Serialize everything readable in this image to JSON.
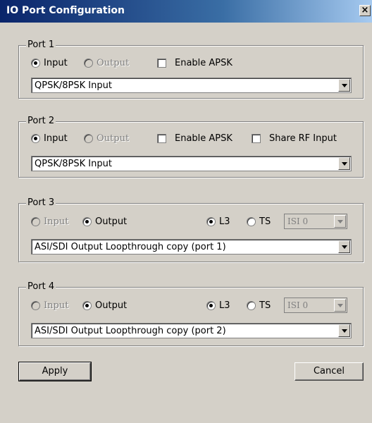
{
  "window": {
    "title": "IO Port Configuration",
    "close_label": "×"
  },
  "ports": [
    {
      "label": "Port 1",
      "input_label": "Input",
      "input_checked": true,
      "output_label": "Output",
      "apsk_label": "Enable APSK",
      "select_value": "QPSK/8PSK Input"
    },
    {
      "label": "Port 2",
      "input_label": "Input",
      "input_checked": true,
      "output_label": "Output",
      "apsk_label": "Enable APSK",
      "share_rf_label": "Share RF Input",
      "select_value": "QPSK/8PSK Input"
    },
    {
      "label": "Port 3",
      "input_label": "Input",
      "output_label": "Output",
      "output_checked": true,
      "l3_label": "L3",
      "l3_checked": true,
      "ts_label": "TS",
      "isi_value": "ISI 0",
      "select_value": "ASI/SDI Output Loopthrough copy (port 1)"
    },
    {
      "label": "Port 4",
      "input_label": "Input",
      "output_label": "Output",
      "output_checked": true,
      "l3_label": "L3",
      "l3_checked": true,
      "ts_label": "TS",
      "isi_value": "ISI 0",
      "select_value": "ASI/SDI Output Loopthrough copy (port 2)"
    }
  ],
  "buttons": {
    "apply": "Apply",
    "cancel": "Cancel"
  }
}
